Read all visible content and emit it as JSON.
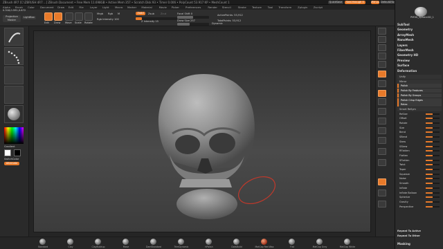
{
  "titlebar": {
    "title": "ZBrush 4R7  [C:\\ZBRUSH 4R7 ...]   ZBrush Document    • Free Mem 11.698GB • Active Mem 357 • Scratch Disk 93 • Timer 0.006 • PolyCount 53.917 KP • MeshCount 1",
    "quicksave": "QuickSave",
    "seethrough": "See-through 0",
    "menus": "Menus",
    "default_script": "DefaultZScript"
  },
  "menubar": [
    "Alpha",
    "Brush",
    "Color",
    "Document",
    "Draw",
    "Edit",
    "File",
    "Layer",
    "Light",
    "Macro",
    "Marker",
    "Material",
    "Movie",
    "Picker",
    "Preferences",
    "Render",
    "Stencil",
    "Stroke",
    "Texture",
    "Tool",
    "Transform",
    "Zplugin",
    "Zscript"
  ],
  "coords": "0.318,0.591,0.672",
  "toolbar": {
    "projection_master": "Projection Master",
    "lightbox": "LightBox",
    "buttons": [
      "Edit",
      "Draw",
      "Move",
      "Scale",
      "Rotate"
    ],
    "mrgb": "Mrgb",
    "rgb": "Rgb",
    "m": "M",
    "zadd": "Zadd",
    "zsub": "Zsub",
    "zcut": "Zcut",
    "rgb_intensity_label": "Rgb Intensity 100",
    "z_intensity_label": "Z Intensity 15",
    "focal_shift_label": "Focal Shift 0",
    "draw_size_label": "Draw Size 257",
    "active_points": "ActivePoints: 53,912",
    "total_points": "TotalPoints: 53,912",
    "dynamic": "Dynamic"
  },
  "leftshelf": {
    "gradient_label": "Gradient",
    "switchcolor_label": "SwitchColor",
    "alternate_label": "Alternate"
  },
  "rightshelf": [
    "BPR",
    "SPix 3",
    "Scroll",
    "Zoom",
    "Actual",
    "AAHalf",
    "Persp",
    "Floor",
    "L.Sym",
    "XYZ",
    "Frame",
    "Move",
    "Scale",
    "Rotate",
    "Line Fill",
    "PolyF",
    "Transp",
    "Solo",
    "Xpose"
  ],
  "tray": {
    "tool_name": "PM3D_Sphere3D_1",
    "sections": [
      "SubTool",
      "Geometry",
      "ArrayMesh",
      "NanoMesh",
      "Layers",
      "FiberMesh",
      "Geometry HD",
      "Preview",
      "Surface",
      "Deformation"
    ],
    "deform_items": [
      {
        "label": "Unify",
        "type": "head"
      },
      {
        "label": "Mirror",
        "type": "head"
      },
      {
        "label": "Polish",
        "type": "orange",
        "value": 0.0
      },
      {
        "label": "Polish By Features",
        "type": "orange",
        "value": 0.0
      },
      {
        "label": "Polish By Groups",
        "type": "orange",
        "value": 0.0
      },
      {
        "label": "Polish Crisp Edges",
        "type": "orange",
        "value": 0.0
      },
      {
        "label": "Relax",
        "type": "orange",
        "value": 0.0
      },
      {
        "label": "Smart ReSym",
        "type": "head"
      },
      {
        "label": "ReSize",
        "type": "row",
        "value": 0.5
      },
      {
        "label": "Offset",
        "type": "row",
        "value": 0.5
      },
      {
        "label": "Rotate",
        "type": "row",
        "value": 0.5
      },
      {
        "label": "Size",
        "type": "row",
        "value": 0.5
      },
      {
        "label": "Bend",
        "type": "row",
        "value": 0.5
      },
      {
        "label": "SBend",
        "type": "row",
        "value": 0.5
      },
      {
        "label": "Skew",
        "type": "row",
        "value": 0.5
      },
      {
        "label": "SSkew",
        "type": "row",
        "value": 0.5
      },
      {
        "label": "RFlatten",
        "type": "row",
        "value": 0.5
      },
      {
        "label": "Flatten",
        "type": "row",
        "value": 0.5
      },
      {
        "label": "SFlatten",
        "type": "row",
        "value": 0.5
      },
      {
        "label": "Twist",
        "type": "row",
        "value": 0.5
      },
      {
        "label": "Taper",
        "type": "row",
        "value": 0.5
      },
      {
        "label": "Squeeze",
        "type": "row",
        "value": 0.5
      },
      {
        "label": "Noise",
        "type": "row",
        "value": 0.5
      },
      {
        "label": "Smooth",
        "type": "row",
        "value": 0.5
      },
      {
        "label": "Inflate",
        "type": "row",
        "value": 0.5
      },
      {
        "label": "Inflate Balloon",
        "type": "row",
        "value": 0.5
      },
      {
        "label": "Spherize",
        "type": "row",
        "value": 0.5
      },
      {
        "label": "Gravity",
        "type": "row",
        "value": 0.5
      },
      {
        "label": "Perspective",
        "type": "row",
        "value": 0.5
      }
    ],
    "repeat_active": "Repeat To Active",
    "repeat_other": "Repeat To Other",
    "masking": "Masking"
  },
  "bottomshelf": [
    "Standard",
    "Clay",
    "ClayBuildup",
    "Move",
    "DamStandard",
    "TrimDynamic",
    "hPolish",
    "DotsBuild",
    "MatCap Red Wax",
    "Flat",
    "MatCap Gray",
    "MatCap White"
  ],
  "colors": {
    "accent": "#e87a2a",
    "bg": "#2b2b2b"
  }
}
